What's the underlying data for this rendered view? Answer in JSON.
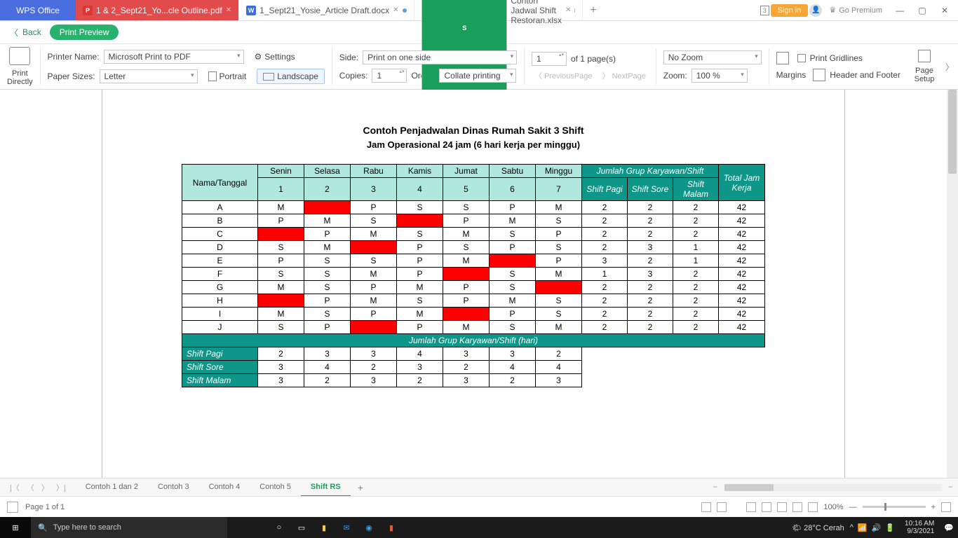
{
  "titlebar": {
    "logo": "WPS Office",
    "tabs": [
      {
        "icon": "P",
        "label": "1 & 2_Sept21_Yo...cle Outline.pdf"
      },
      {
        "icon": "W",
        "label": "1_Sept21_Yosie_Article Draft.docx"
      },
      {
        "icon": "S",
        "label": "Contoh Jadwal Shift Restoran.xlsx"
      }
    ],
    "doc_count": "3",
    "signin": "Sign in",
    "premium": "Go Premium"
  },
  "backbar": {
    "back": "Back",
    "preview": "Print Preview"
  },
  "ribbon": {
    "print": "Print\nDirectly",
    "printer_lbl": "Printer Name:",
    "printer_val": "Microsoft Print to PDF",
    "paper_lbl": "Paper Sizes:",
    "paper_val": "Letter",
    "settings": "Settings",
    "portrait": "Portrait",
    "landscape": "Landscape",
    "side_lbl": "Side:",
    "side_val": "Print on one side",
    "copies_lbl": "Copies:",
    "copies_val": "1",
    "order_lbl": "Order:",
    "order_val": "Collate printing",
    "page_val": "1",
    "page_of": "of 1 page(s)",
    "prev": "PreviousPage",
    "next": "NextPage",
    "zoom_sel": "No Zoom",
    "zoom_lbl": "Zoom:",
    "zoom_val": "100 %",
    "margins": "Margins",
    "gridlines": "Print Gridlines",
    "hf": "Header and Footer",
    "setup": "Page\nSetup"
  },
  "chart_data": {
    "type": "table",
    "title": "Contoh Penjadwalan Dinas Rumah Sakit 3 Shift",
    "subtitle": "Jam Operasional 24 jam (6 hari kerja per minggu)",
    "row_header": "Nama/Tanggal",
    "days": [
      "Senin",
      "Selasa",
      "Rabu",
      "Kamis",
      "Jumat",
      "Sabtu",
      "Minggu"
    ],
    "day_nums": [
      "1",
      "2",
      "3",
      "4",
      "5",
      "6",
      "7"
    ],
    "shift_group_hdr": "Jumlah Grup Karyawan/Shift",
    "shift_cols": [
      "Shift  Pagi",
      "Shift  Sore",
      "Shift Malam"
    ],
    "total_hdr": "Total Jam Kerja",
    "rows": [
      {
        "n": "A",
        "d": [
          "M",
          "",
          "P",
          "S",
          "S",
          "P",
          "M"
        ],
        "s": [
          "2",
          "2",
          "2"
        ],
        "t": "42",
        "red": [
          1
        ]
      },
      {
        "n": "B",
        "d": [
          "P",
          "M",
          "S",
          "",
          "P",
          "M",
          "S"
        ],
        "s": [
          "2",
          "2",
          "2"
        ],
        "t": "42",
        "red": [
          3
        ]
      },
      {
        "n": "C",
        "d": [
          "",
          "P",
          "M",
          "S",
          "M",
          "S",
          "P"
        ],
        "s": [
          "2",
          "2",
          "2"
        ],
        "t": "42",
        "red": [
          0
        ]
      },
      {
        "n": "D",
        "d": [
          "S",
          "M",
          "",
          "P",
          "S",
          "P",
          "S"
        ],
        "s": [
          "2",
          "3",
          "1"
        ],
        "t": "42",
        "red": [
          2
        ]
      },
      {
        "n": "E",
        "d": [
          "P",
          "S",
          "S",
          "P",
          "M",
          "",
          "P"
        ],
        "s": [
          "3",
          "2",
          "1"
        ],
        "t": "42",
        "red": [
          5
        ]
      },
      {
        "n": "F",
        "d": [
          "S",
          "S",
          "M",
          "P",
          "",
          "S",
          "M"
        ],
        "s": [
          "1",
          "3",
          "2"
        ],
        "t": "42",
        "red": [
          4
        ]
      },
      {
        "n": "G",
        "d": [
          "M",
          "S",
          "P",
          "M",
          "P",
          "S",
          ""
        ],
        "s": [
          "2",
          "2",
          "2"
        ],
        "t": "42",
        "red": [
          6
        ]
      },
      {
        "n": "H",
        "d": [
          "",
          "P",
          "M",
          "S",
          "P",
          "M",
          "S"
        ],
        "s": [
          "2",
          "2",
          "2"
        ],
        "t": "42",
        "red": [
          0
        ]
      },
      {
        "n": "I",
        "d": [
          "M",
          "S",
          "P",
          "M",
          "",
          "P",
          "S"
        ],
        "s": [
          "2",
          "2",
          "2"
        ],
        "t": "42",
        "red": [
          4
        ]
      },
      {
        "n": "J",
        "d": [
          "S",
          "P",
          "",
          "P",
          "M",
          "S",
          "M"
        ],
        "s": [
          "2",
          "2",
          "2"
        ],
        "t": "42",
        "red": [
          2
        ]
      }
    ],
    "summary_hdr": "Jumlah Grup Karyawan/Shift  (hari)",
    "summary": [
      {
        "lbl": "Shift Pagi",
        "v": [
          "2",
          "3",
          "3",
          "4",
          "3",
          "3",
          "2"
        ]
      },
      {
        "lbl": "Shift Sore",
        "v": [
          "3",
          "4",
          "2",
          "3",
          "2",
          "4",
          "4"
        ]
      },
      {
        "lbl": "Shift Malam",
        "v": [
          "3",
          "2",
          "3",
          "2",
          "3",
          "2",
          "3"
        ]
      }
    ]
  },
  "sheets": {
    "tabs": [
      "Contoh 1 dan 2",
      "Contoh 3",
      "Contoh 4",
      "Contoh 5",
      "Shift RS"
    ],
    "active": 4
  },
  "status": {
    "page": "Page 1 of 1",
    "zoom": "100%"
  },
  "taskbar": {
    "search": "Type here to search",
    "weather": "28°C  Cerah",
    "time": "10:16 AM",
    "date": "9/3/2021"
  }
}
